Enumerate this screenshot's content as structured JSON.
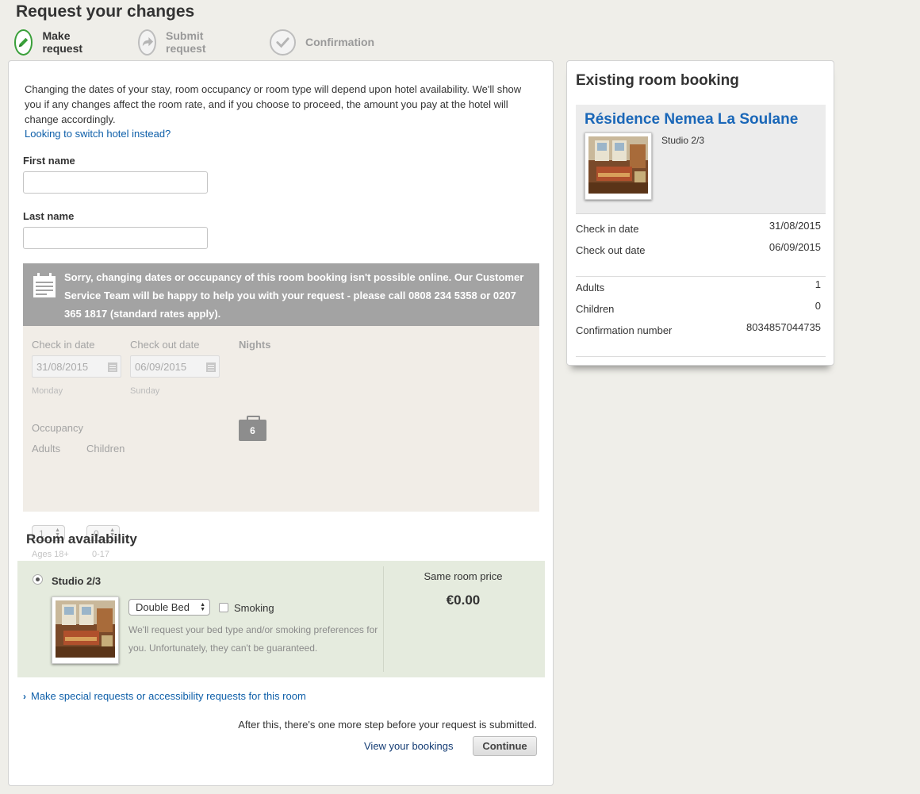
{
  "page": {
    "title": "Request your changes"
  },
  "steps": [
    {
      "label": "Make request",
      "icon": "pencil-icon",
      "active": true
    },
    {
      "label": "Submit request",
      "icon": "arrow-icon",
      "active": false
    },
    {
      "label": "Confirmation",
      "icon": "check-icon",
      "active": false
    }
  ],
  "intro": {
    "text": "Changing the dates of your stay, room occupancy or room type will depend upon hotel availability. We'll show you if any changes affect the room rate, and if you choose to proceed, the amount you pay at the hotel will change accordingly.",
    "switch_link": "Looking to switch hotel instead?"
  },
  "form": {
    "first_name_label": "First name",
    "first_name_value": "",
    "last_name_label": "Last name",
    "last_name_value": ""
  },
  "notice": {
    "icon": "calendar-icon",
    "text": "Sorry, changing dates or occupancy of this room booking isn't possible online. Our Customer Service Team will be happy to help you with your request - please call 0808 234 5358 or 0207 365 1817 (standard rates apply)."
  },
  "dates": {
    "checkin_label": "Check in date",
    "checkin_value": "31/08/2015",
    "checkin_day": "Monday",
    "checkout_label": "Check out date",
    "checkout_value": "06/09/2015",
    "checkout_day": "Sunday",
    "nights_label": "Nights",
    "nights_value": "6"
  },
  "occupancy": {
    "label": "Occupancy",
    "adults_label": "Adults",
    "adults_value": "1",
    "adults_hint": "Ages 18+",
    "children_label": "Children",
    "children_value": "0",
    "children_hint": "0-17"
  },
  "room_availability": {
    "title": "Room availability",
    "room_name": "Studio 2/3",
    "bed_type": "Double Bed",
    "smoking_label": "Smoking",
    "smoking_checked": false,
    "note": "We'll request your bed type and/or smoking preferences for you. Unfortunately, they can't be guaranteed.",
    "price_label": "Same room price",
    "price_value": "€0.00"
  },
  "footer": {
    "special_link": "Make special requests or accessibility requests for this room",
    "after_note": "After this, there's one more step before your request is submitted.",
    "bookings_link": "View your bookings",
    "continue_label": "Continue"
  },
  "existing_booking": {
    "title": "Existing room booking",
    "hotel_name": "Résidence Nemea La Soulane",
    "room_type": "Studio 2/3",
    "checkin_label": "Check in date",
    "checkin_value": "31/08/2015",
    "checkout_label": "Check out date",
    "checkout_value": "06/09/2015",
    "adults_label": "Adults",
    "adults_value": "1",
    "children_label": "Children",
    "children_value": "0",
    "confirmation_label": "Confirmation number",
    "confirmation_value": "8034857044735"
  },
  "colors": {
    "link": "#0e5fa9",
    "hotel_name": "#1a67b8",
    "active_step": "#3aa03a",
    "room_panel": "#e5ebde",
    "notice_bg": "#a3a3a3"
  }
}
